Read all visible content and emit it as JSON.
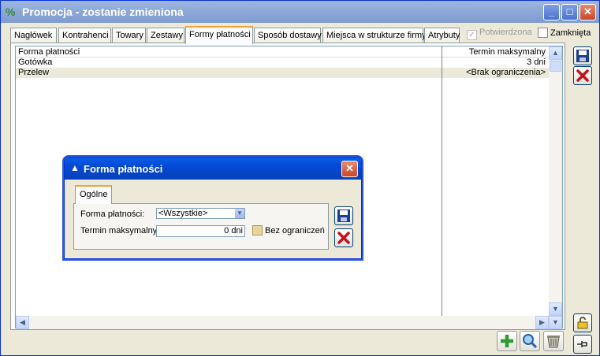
{
  "window": {
    "title": "Promocja - zostanie zmieniona",
    "icon": "percent-icon",
    "controls": {
      "minimize": "_",
      "maximize": "□",
      "close": "✕"
    }
  },
  "tabs": [
    {
      "label": "Nagłówek"
    },
    {
      "label": "Kontrahenci"
    },
    {
      "label": "Towary"
    },
    {
      "label": "Zestawy"
    },
    {
      "label": "Formy płatności",
      "active": true
    },
    {
      "label": "Sposób dostawy"
    },
    {
      "label": "Miejsca w strukturze firmy"
    },
    {
      "label": "Atrybuty"
    }
  ],
  "checks": {
    "confirmed": {
      "label": "Potwierdzona",
      "checked": true,
      "disabled": true
    },
    "closed": {
      "label": "Zamknięta",
      "checked": false
    }
  },
  "grid": {
    "columns": [
      "Forma płatności",
      "Termin maksymalny"
    ],
    "rows": [
      {
        "name": "Gotówka",
        "term": "3 dni"
      },
      {
        "name": "Przelew",
        "term": "<Brak ograniczenia>"
      }
    ]
  },
  "side_buttons": [
    "save-icon",
    "cancel-icon",
    "lock-icon",
    "pin-icon"
  ],
  "bottom_buttons": [
    "add-icon",
    "search-icon",
    "delete-basket-icon"
  ],
  "dialog": {
    "title": "Forma płatności",
    "tab": "Ogólne",
    "payment_label": "Forma płatności:",
    "payment_value": "<Wszystkie>",
    "term_label": "Termin maksymalny:",
    "term_value": "0 dni",
    "no_limit_label": "Bez ograniczeń",
    "no_limit_checked": false
  },
  "colors": {
    "title_inactive": "#8ea9d8",
    "dialog_title": "#0349d5",
    "tab_highlight": "#f2a33a",
    "row_alt": "#ebe9d9"
  }
}
